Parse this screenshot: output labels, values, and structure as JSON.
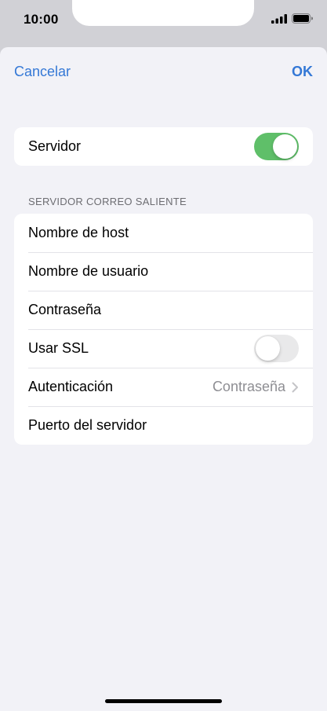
{
  "status_bar": {
    "time": "10:00",
    "icons": [
      "signal-icon",
      "battery-icon"
    ]
  },
  "nav": {
    "cancel_label": "Cancelar",
    "ok_label": "OK"
  },
  "server_group": {
    "label": "Servidor",
    "toggle_on": true
  },
  "outgoing_section": {
    "header": "SERVIDOR CORREO SALIENTE",
    "rows": {
      "host": {
        "label": "Nombre de host"
      },
      "username": {
        "label": "Nombre de usuario"
      },
      "password": {
        "label": "Contraseña"
      },
      "ssl": {
        "label": "Usar SSL",
        "toggle_on": false
      },
      "auth": {
        "label": "Autenticación",
        "value": "Contraseña"
      },
      "port": {
        "label": "Puerto del servidor"
      }
    }
  },
  "colors": {
    "accent": "#3478d6",
    "toggle_on": "#5fbf69",
    "toggle_off": "#e9e9ea",
    "background": "#f2f2f7"
  }
}
